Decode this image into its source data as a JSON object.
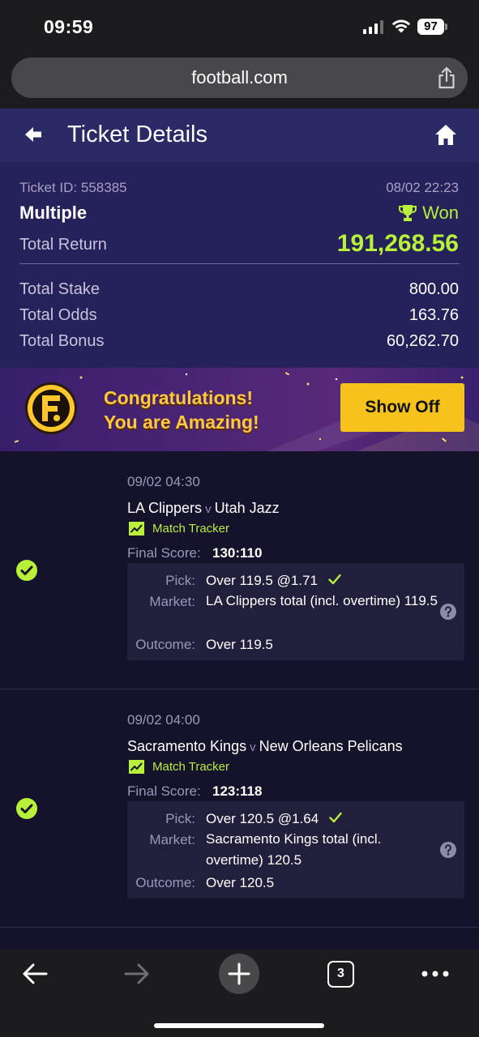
{
  "status_bar": {
    "time": "09:59",
    "battery": "97"
  },
  "browser": {
    "url": "football.com",
    "tab_count": "3"
  },
  "header": {
    "title": "Ticket Details"
  },
  "ticket": {
    "id_text": "Ticket ID: 558385",
    "datetime": "08/02 22:23",
    "type": "Multiple",
    "status": "Won",
    "total_return_label": "Total Return",
    "total_return": "191,268.56",
    "rows": [
      {
        "label": "Total Stake",
        "value": "800.00"
      },
      {
        "label": "Total Odds",
        "value": "163.76"
      },
      {
        "label": "Total Bonus",
        "value": "60,262.70"
      }
    ]
  },
  "banner": {
    "line1": "Congratulations!",
    "line2": "You are Amazing!",
    "button_label": "Show Off"
  },
  "selections": [
    {
      "date": "09/02 04:30",
      "home": "LA Clippers",
      "vs": "v",
      "away": "Utah Jazz",
      "tracker_label": "Match Tracker",
      "final_score_label": "Final Score:",
      "final_score": "130:110",
      "pick_label": "Pick:",
      "pick": "Over 119.5 @1.71",
      "market_label": "Market:",
      "market": "LA Clippers total (incl. overtime) 119.5",
      "outcome_label": "Outcome:",
      "outcome": "Over 119.5"
    },
    {
      "date": "09/02 04:00",
      "home": "Sacramento Kings",
      "vs": "v",
      "away": "New Orleans Pelicans",
      "tracker_label": "Match Tracker",
      "final_score_label": "Final Score:",
      "final_score": "123:118",
      "pick_label": "Pick:",
      "pick": "Over 120.5 @1.64",
      "market_label": "Market:",
      "market": "Sacramento Kings total (incl. overtime) 120.5",
      "outcome_label": "Outcome:",
      "outcome": "Over 120.5"
    }
  ],
  "colors": {
    "accent_green": "#b8f03a",
    "header_bg": "#2b2966",
    "summary_bg": "#25215a",
    "button_yellow": "#f7c21b"
  },
  "icons": [
    "back-arrow-icon",
    "home-icon",
    "share-icon",
    "trophy-icon",
    "check-circle-icon",
    "chart-icon",
    "help-icon",
    "checkmark-icon",
    "plus-icon",
    "more-icon",
    "football-logo-icon"
  ]
}
